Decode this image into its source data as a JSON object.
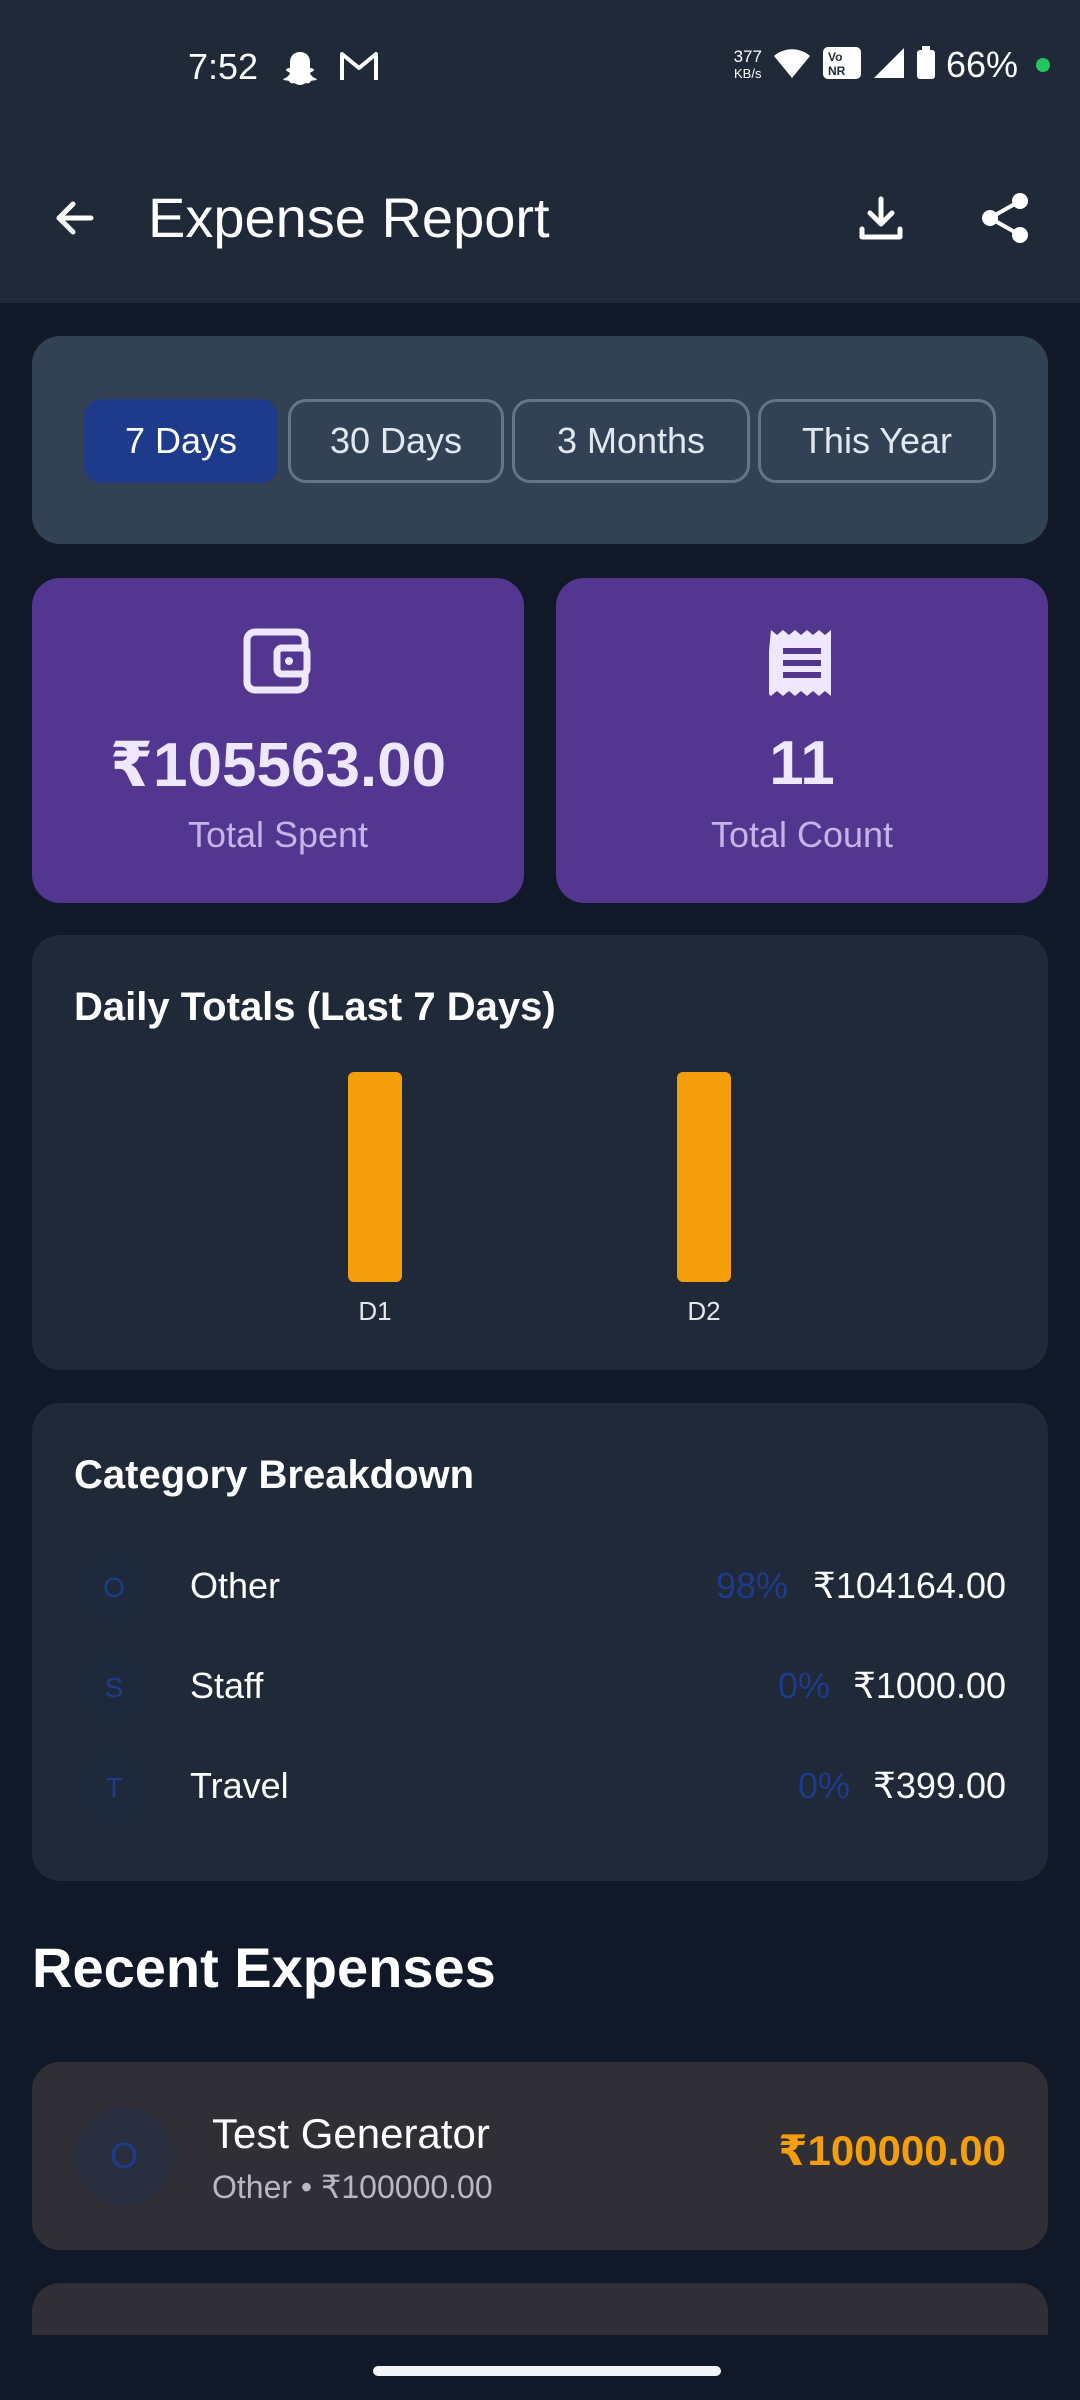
{
  "status_bar": {
    "time": "7:52",
    "speed_value": "377",
    "speed_unit": "KB/s",
    "battery": "66%",
    "icons": [
      "snapchat-icon",
      "gmail-icon",
      "wifi-icon",
      "vonr-icon",
      "signal-icon",
      "battery-icon"
    ]
  },
  "app_bar": {
    "title": "Expense Report",
    "back_icon": "arrow-left-icon",
    "download_icon": "download-icon",
    "share_icon": "share-icon"
  },
  "period_filter": {
    "options": [
      "7 Days",
      "30 Days",
      "3 Months",
      "This Year"
    ],
    "selected": "7 Days"
  },
  "stats": {
    "total_spent_value": "₹105563.00",
    "total_spent_label": "Total Spent",
    "total_count_value": "11",
    "total_count_label": "Total Count",
    "spent_icon": "wallet-icon",
    "count_icon": "receipt-icon"
  },
  "daily_chart": {
    "title": "Daily Totals (Last 7 Days)"
  },
  "chart_data": {
    "type": "bar",
    "title": "Daily Totals (Last 7 Days)",
    "categories": [
      "D1",
      "D2"
    ],
    "values": [
      1,
      1
    ],
    "bar_color": "#f59e0b",
    "xlabel": "",
    "ylabel": ""
  },
  "category_breakdown": {
    "title": "Category Breakdown",
    "items": [
      {
        "initial": "O",
        "name": "Other",
        "percent": "98%",
        "amount": "₹104164.00"
      },
      {
        "initial": "S",
        "name": "Staff",
        "percent": "0%",
        "amount": "₹1000.00"
      },
      {
        "initial": "T",
        "name": "Travel",
        "percent": "0%",
        "amount": "₹399.00"
      }
    ]
  },
  "recent_expenses": {
    "title": "Recent Expenses",
    "items": [
      {
        "initial": "O",
        "name": "Test Generator",
        "subtitle": "Other • ₹100000.00",
        "amount": "₹100000.00"
      }
    ]
  },
  "colors": {
    "accent_orange": "#f59e0b",
    "stat_card": "#52368f",
    "chip_active": "#1e3a8a",
    "background": "#111827",
    "card": "#1f2937"
  }
}
